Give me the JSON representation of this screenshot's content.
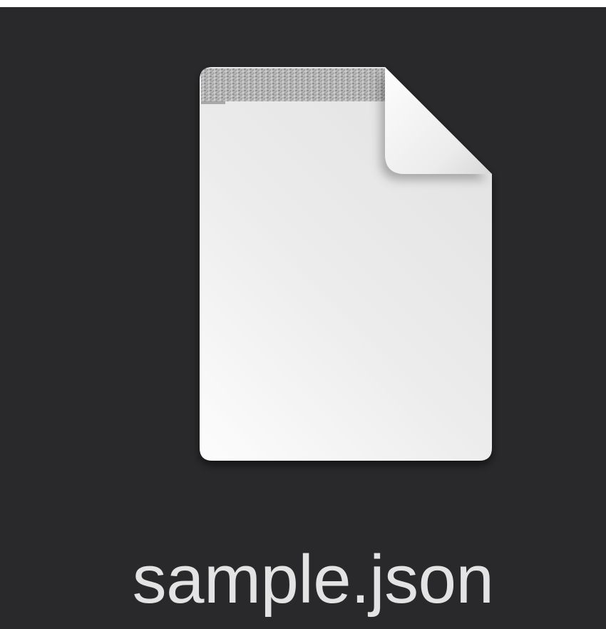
{
  "file": {
    "name": "sample.json",
    "icon": "document-icon"
  },
  "colors": {
    "desktop_background": "#29292b",
    "label_text": "#e3e3e3",
    "page_light": "#fafafa",
    "page_shade": "#e4e4e4"
  }
}
